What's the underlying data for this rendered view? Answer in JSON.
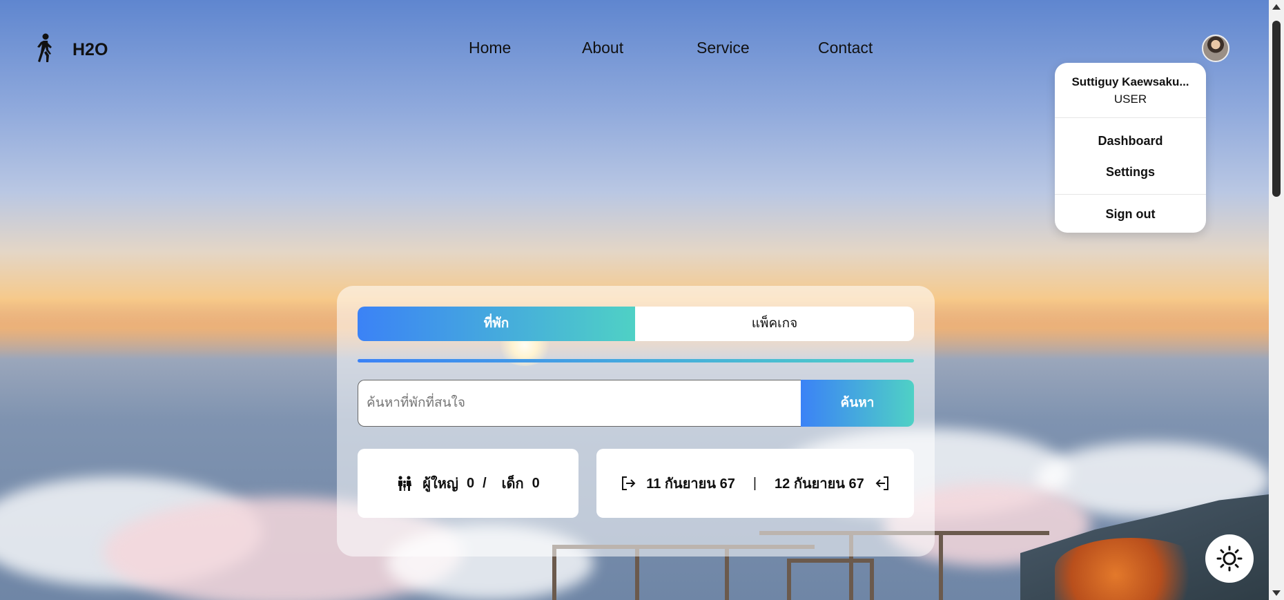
{
  "brand": {
    "name": "H2O",
    "icon": "walking-person-icon"
  },
  "nav": {
    "items": [
      {
        "label": "Home"
      },
      {
        "label": "About"
      },
      {
        "label": "Service"
      },
      {
        "label": "Contact"
      }
    ]
  },
  "user_menu": {
    "name": "Suttiguy Kaewsaku...",
    "role": "USER",
    "dashboard": "Dashboard",
    "settings": "Settings",
    "sign_out": "Sign out"
  },
  "search_panel": {
    "tabs": [
      {
        "label": "ที่พัก",
        "active": true
      },
      {
        "label": "แพ็คเกจ",
        "active": false
      }
    ],
    "input_placeholder": "ค้นหาที่พักที่สนใจ",
    "input_value": "",
    "search_label": "ค้นหา",
    "guests": {
      "icon": "family-icon",
      "adult_label": "ผู้ใหญ่",
      "adult_count": "0",
      "separator": "/",
      "child_label": "เด็ก",
      "child_count": "0"
    },
    "dates": {
      "check_in": "11 กันยายน 67",
      "divider": "|",
      "check_out": "12 กันยายน 67",
      "check_in_icon": "sign-in-icon",
      "check_out_icon": "sign-out-icon"
    }
  },
  "theme_toggle": {
    "icon": "sun-icon"
  },
  "colors": {
    "accent_start": "#3b82f6",
    "accent_end": "#4fd1c5"
  }
}
